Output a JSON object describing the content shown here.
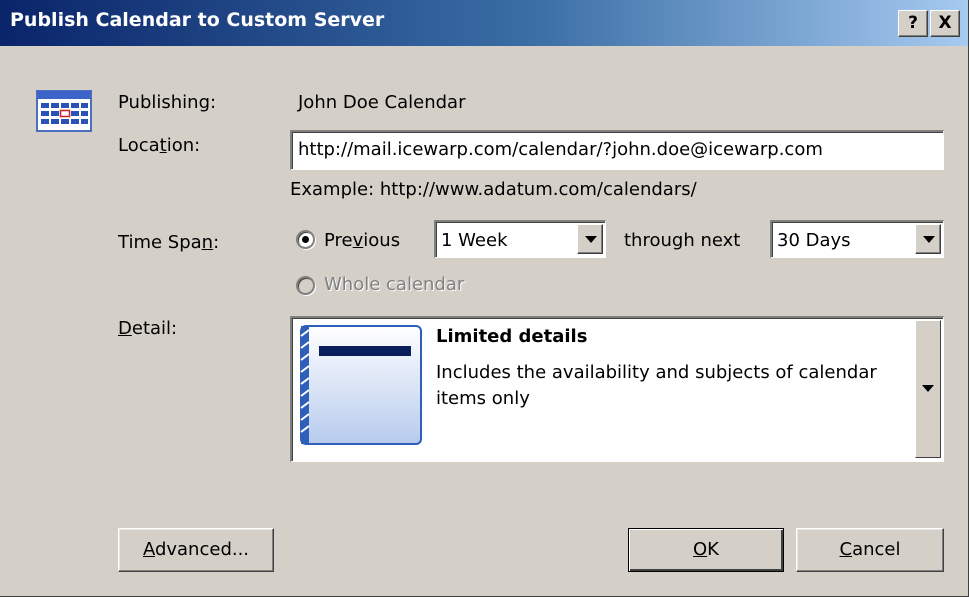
{
  "window": {
    "title": "Publish Calendar to Custom Server",
    "help_label": "?",
    "close_label": "X"
  },
  "publishing": {
    "label": "Publishing:",
    "value": "John Doe Calendar"
  },
  "location": {
    "label_pre": "Loca",
    "label_key": "t",
    "label_post": "ion:",
    "value": "http://mail.icewarp.com/calendar/?john.doe@icewarp.com",
    "example": "Example: http://www.adatum.com/calendars/"
  },
  "time_span": {
    "label_pre": "Time Spa",
    "label_key": "n",
    "label_post": ":",
    "previous_pre": "Pre",
    "previous_key": "v",
    "previous_post": "ious",
    "previous_checked": true,
    "previous_value": "1 Week",
    "through_label": "through next",
    "through_value": "30 Days",
    "whole_calendar_label": "Whole calendar",
    "whole_calendar_enabled": false
  },
  "detail": {
    "label_key": "D",
    "label_post": "etail:",
    "option_title": "Limited details",
    "option_description": "Includes the availability and subjects of calendar items only"
  },
  "buttons": {
    "advanced_key": "A",
    "advanced_post": "dvanced...",
    "ok_key": "O",
    "ok_post": "K",
    "cancel_key": "C",
    "cancel_post": "ancel"
  },
  "icons": {
    "app_icon": "calendar-icon",
    "detail_icon": "calendar-page-icon",
    "dropdown_icon": "dropdown-arrow-icon"
  },
  "colors": {
    "title_start": "#0a246a",
    "title_end": "#a6caf0",
    "dialog_bg": "#d4d0c8",
    "disabled_text": "#808080"
  }
}
